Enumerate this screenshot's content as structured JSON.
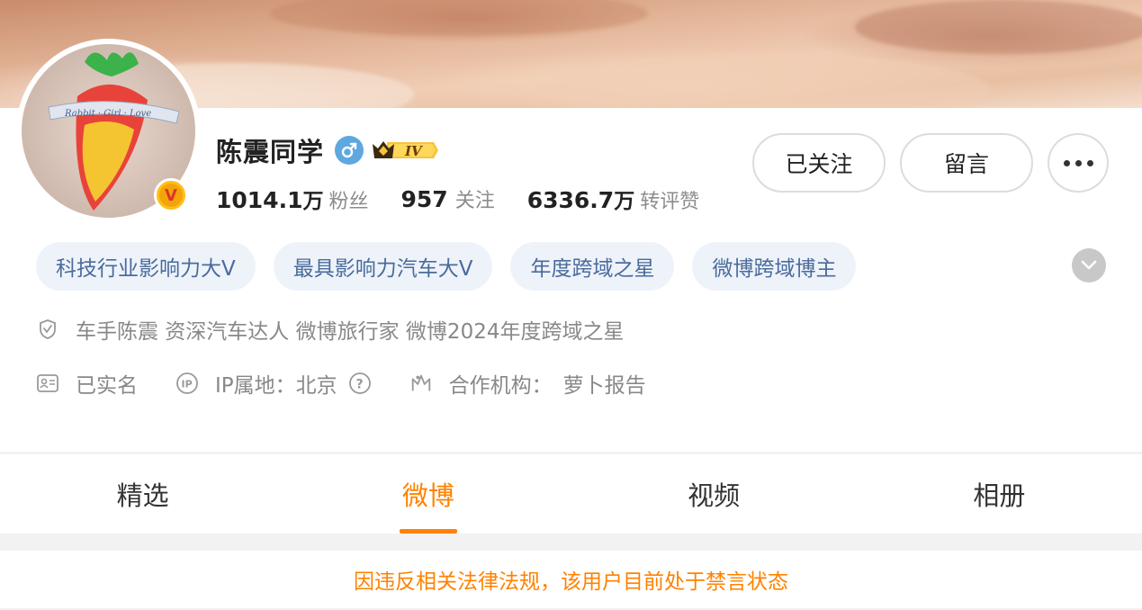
{
  "profile": {
    "name": "陈震同学",
    "gender_icon": "male-icon",
    "level_badge": "IV",
    "verified_badge": "V",
    "stats": {
      "fans_num": "1014.1",
      "fans_unit": "万",
      "fans_label": "粉丝",
      "following_num": "957",
      "following_label": "关注",
      "likes_num": "6336.7",
      "likes_unit": "万",
      "likes_label": "转评赞"
    }
  },
  "actions": {
    "follow_label": "已关注",
    "message_label": "留言",
    "more_icon": "more-icon"
  },
  "tags": [
    "科技行业影响力大V",
    "最具影响力汽车大V",
    "年度跨域之星",
    "微博跨域博主"
  ],
  "description": "车手陈震 资深汽车达人 微博旅行家 微博2024年度跨域之星",
  "meta": {
    "realname": "已实名",
    "ip_label": "IP属地：",
    "ip_value": "北京",
    "org_label": "合作机构：",
    "org_value": "萝卜报告"
  },
  "tabs": [
    {
      "label": "精选",
      "active": false
    },
    {
      "label": "微博",
      "active": true
    },
    {
      "label": "视频",
      "active": false
    },
    {
      "label": "相册",
      "active": false
    }
  ],
  "notice": "因违反相关法律法规，该用户目前处于禁言状态",
  "colors": {
    "accent": "#ff8200",
    "tag_text": "#4a6b9c",
    "tag_bg": "#eef3fa",
    "verified": "#ffbf1a",
    "gender": "#5ea8e0"
  }
}
